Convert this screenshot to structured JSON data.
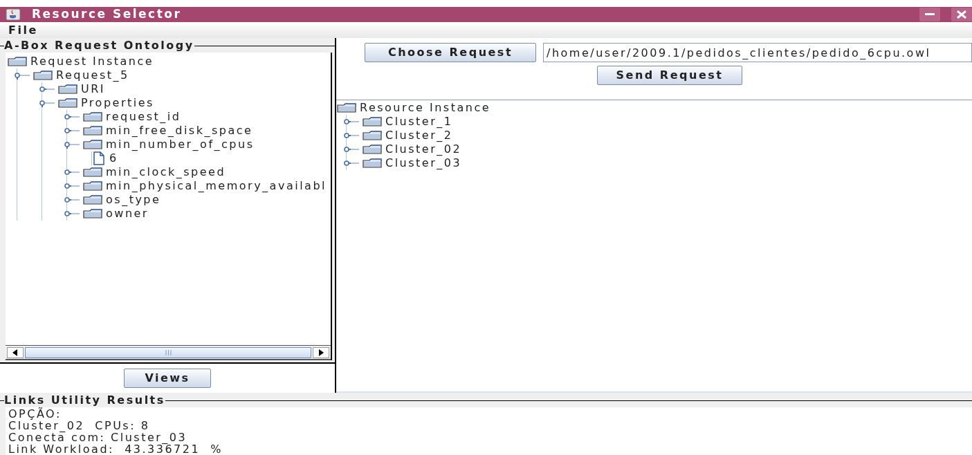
{
  "window": {
    "title": "Resource Selector"
  },
  "menu": [
    "File"
  ],
  "request_panel": {
    "title": "A-Box Request Ontology",
    "tree": [
      {
        "label": "Request Instance",
        "kind": "folder",
        "children": [
          {
            "label": "Request_5",
            "kind": "folder",
            "expanded": true,
            "children": [
              {
                "label": "URI",
                "kind": "folder",
                "expanded": false
              },
              {
                "label": "Properties",
                "kind": "folder",
                "expanded": true,
                "children": [
                  {
                    "label": "request_id",
                    "kind": "folder",
                    "expanded": false
                  },
                  {
                    "label": "min_free_disk_space",
                    "kind": "folder",
                    "expanded": false
                  },
                  {
                    "label": "min_number_of_cpus",
                    "kind": "folder",
                    "expanded": true,
                    "children": [
                      {
                        "label": "6",
                        "kind": "file"
                      }
                    ]
                  },
                  {
                    "label": "min_clock_speed",
                    "kind": "folder",
                    "expanded": false
                  },
                  {
                    "label": "min_physical_memory_availabl",
                    "kind": "folder",
                    "expanded": false
                  },
                  {
                    "label": "os_type",
                    "kind": "folder",
                    "expanded": false
                  },
                  {
                    "label": "owner",
                    "kind": "folder",
                    "expanded": false
                  }
                ]
              }
            ]
          }
        ]
      }
    ],
    "views_button": "Views"
  },
  "choose_button": "Choose Request",
  "file_path": "/home/user/2009.1/pedidos_clientes/pedido_6cpu.owl",
  "send_button": "Send Request",
  "resource_tree": [
    {
      "label": "Resource Instance",
      "kind": "folder",
      "children": [
        {
          "label": "Cluster_1",
          "kind": "folder",
          "expanded": false
        },
        {
          "label": "Cluster_2",
          "kind": "folder",
          "expanded": false
        },
        {
          "label": "Cluster_02",
          "kind": "folder",
          "expanded": false
        },
        {
          "label": "Cluster_03",
          "kind": "folder",
          "expanded": false
        }
      ]
    }
  ],
  "results": {
    "title": "Links Utility Results",
    "lines": [
      "OPÇÃO:",
      "Cluster_02  CPUs: 8",
      "Conecta com: Cluster_03",
      "Link Workload:  43.336721  %"
    ]
  }
}
